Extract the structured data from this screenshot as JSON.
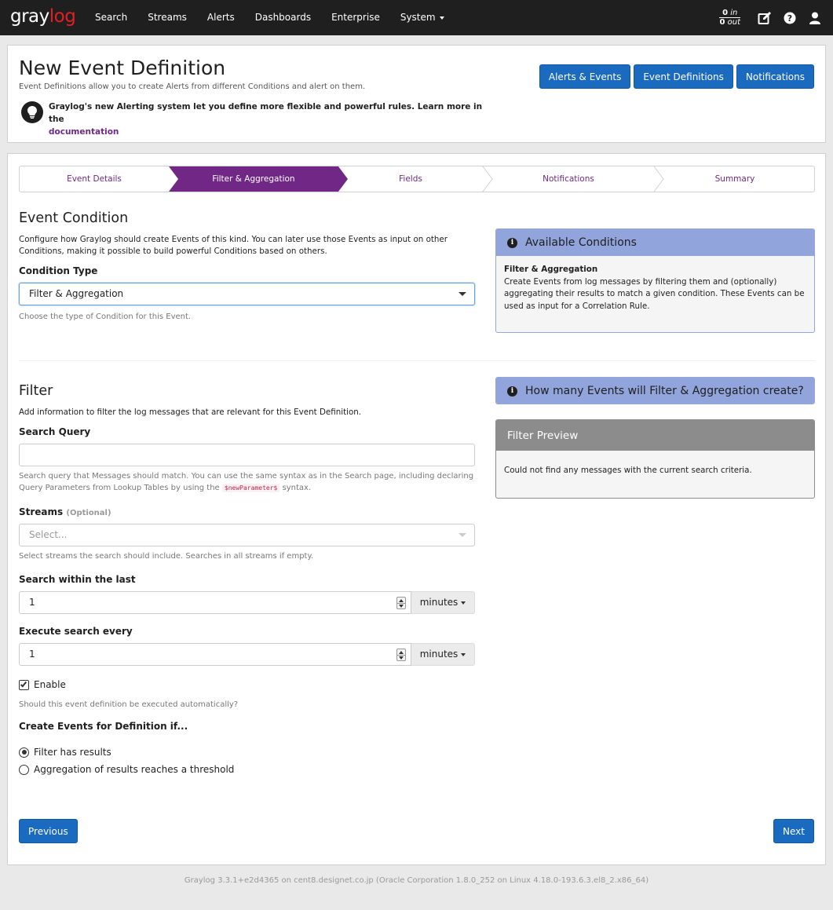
{
  "nav": {
    "brand_a": "gray",
    "brand_b": "log",
    "links": [
      "Search",
      "Streams",
      "Alerts",
      "Dashboards",
      "Enterprise",
      "System"
    ],
    "throughput_in": "0",
    "throughput_in_label": "in",
    "throughput_out": "0",
    "throughput_out_label": "out",
    "icons": [
      "edit-icon",
      "help-icon",
      "user-icon"
    ]
  },
  "header": {
    "title": "New Event Definition",
    "description": "Event Definitions allow you to create Alerts from different Conditions and alert on them.",
    "info_text": "Graylog's new Alerting system let you define more flexible and powerful rules. Learn more in the",
    "info_link": "documentation",
    "buttons": [
      "Alerts & Events",
      "Event Definitions",
      "Notifications"
    ]
  },
  "wizard": {
    "steps": [
      "Event Details",
      "Filter & Aggregation",
      "Fields",
      "Notifications",
      "Summary"
    ],
    "active_index": 1
  },
  "condition": {
    "heading": "Event Condition",
    "help": "Configure how Graylog should create Events of this kind. You can later use those Events as input on other Conditions, making it possible to build powerful Conditions based on others.",
    "type_label": "Condition Type",
    "type_value": "Filter & Aggregation",
    "type_help": "Choose the type of Condition for this Event."
  },
  "available_conditions": {
    "title": "Available Conditions",
    "item_title": "Filter & Aggregation",
    "item_text": "Create Events from log messages by filtering them and (optionally) aggregating their results to match a given condition. These Events can be used as input for a Correlation Rule."
  },
  "filter": {
    "heading": "Filter",
    "help": "Add information to filter the log messages that are relevant for this Event Definition.",
    "query_label": "Search Query",
    "query_value": "",
    "query_help_a": "Search query that Messages should match. You can use the same syntax as in the Search page, including declaring Query Parameters from Lookup Tables by using the",
    "query_help_code": "$newParameter$",
    "query_help_b": "syntax.",
    "streams_label": "Streams",
    "streams_optional": "(Optional)",
    "streams_placeholder": "Select...",
    "streams_help": "Select streams the search should include. Searches in all streams if empty.",
    "within_label": "Search within the last",
    "within_value": "1",
    "within_unit": "minutes",
    "every_label": "Execute search every",
    "every_value": "1",
    "every_unit": "minutes",
    "enable_label": "Enable",
    "enable_checked": true,
    "enable_help": "Should this event definition be executed automatically?",
    "create_label": "Create Events for Definition if...",
    "radio_options": [
      "Filter has results",
      "Aggregation of results reaches a threshold"
    ],
    "radio_selected": 0
  },
  "how_many": {
    "title": "How many Events will Filter & Aggregation create?"
  },
  "preview": {
    "title": "Filter Preview",
    "text": "Could not find any messages with the current search criteria."
  },
  "actions": {
    "previous": "Previous",
    "next": "Next"
  },
  "footer": "Graylog 3.3.1+e2d4365 on cent8.designet.co.jp (Oracle Corporation 1.8.0_252 on Linux 4.18.0-193.6.3.el8_2.x86_64)",
  "colors": {
    "navbar": "#1f1f1f",
    "brand_accent": "#e31e24",
    "primary": "#1a6ac0",
    "wizard_active": "#702785",
    "info_header": "#91a4db",
    "preview_header": "#8c8c8c"
  }
}
